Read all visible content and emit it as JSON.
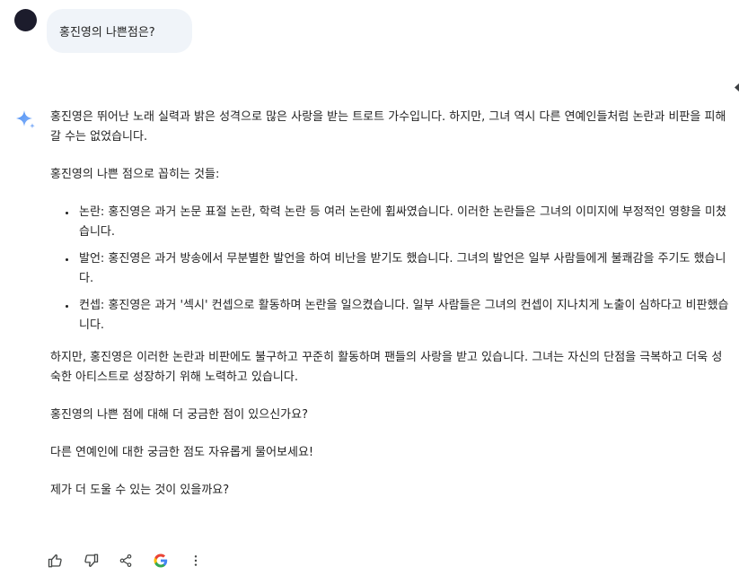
{
  "prompt": {
    "text": "홍진영의 나쁜점은?"
  },
  "response": {
    "intro": "홍진영은 뛰어난 노래 실력과 밝은 성격으로 많은 사랑을 받는 트로트 가수입니다. 하지만, 그녀 역시 다른 연예인들처럼 논란과 비판을 피해갈 수는 없었습니다.",
    "list_heading": "홍진영의 나쁜 점으로 꼽히는 것들:",
    "items": [
      "논란: 홍진영은 과거 논문 표절 논란, 학력 논란 등 여러 논란에 휩싸였습니다. 이러한 논란들은 그녀의 이미지에 부정적인 영향을 미쳤습니다.",
      "발언: 홍진영은 과거 방송에서 무분별한 발언을 하여 비난을 받기도 했습니다. 그녀의 발언은 일부 사람들에게 불쾌감을 주기도 했습니다.",
      "컨셉: 홍진영은 과거 '섹시' 컨셉으로 활동하며 논란을 일으켰습니다. 일부 사람들은 그녀의 컨셉이 지나치게 노출이 심하다고 비판했습니다."
    ],
    "closing": "하지만, 홍진영은 이러한 논란과 비판에도 불구하고 꾸준히 활동하며 팬들의 사랑을 받고 있습니다. 그녀는 자신의 단점을 극복하고 더욱 성숙한 아티스트로 성장하기 위해 노력하고 있습니다.",
    "question1": "홍진영의 나쁜 점에 대해 더 궁금한 점이 있으신가요?",
    "question2": "다른 연예인에 대한 궁금한 점도 자유롭게 물어보세요!",
    "question3": "제가 더 도울 수 있는 것이 있을까요?"
  },
  "actions": {
    "icons": [
      "thumbs-up-icon",
      "thumbs-down-icon",
      "share-icon",
      "google-icon",
      "more-vert-icon"
    ]
  },
  "colors": {
    "prompt_bg": "#f0f4f9",
    "text": "#1f1f1f",
    "icon": "#444746",
    "spark_blue": "#4285f4"
  }
}
